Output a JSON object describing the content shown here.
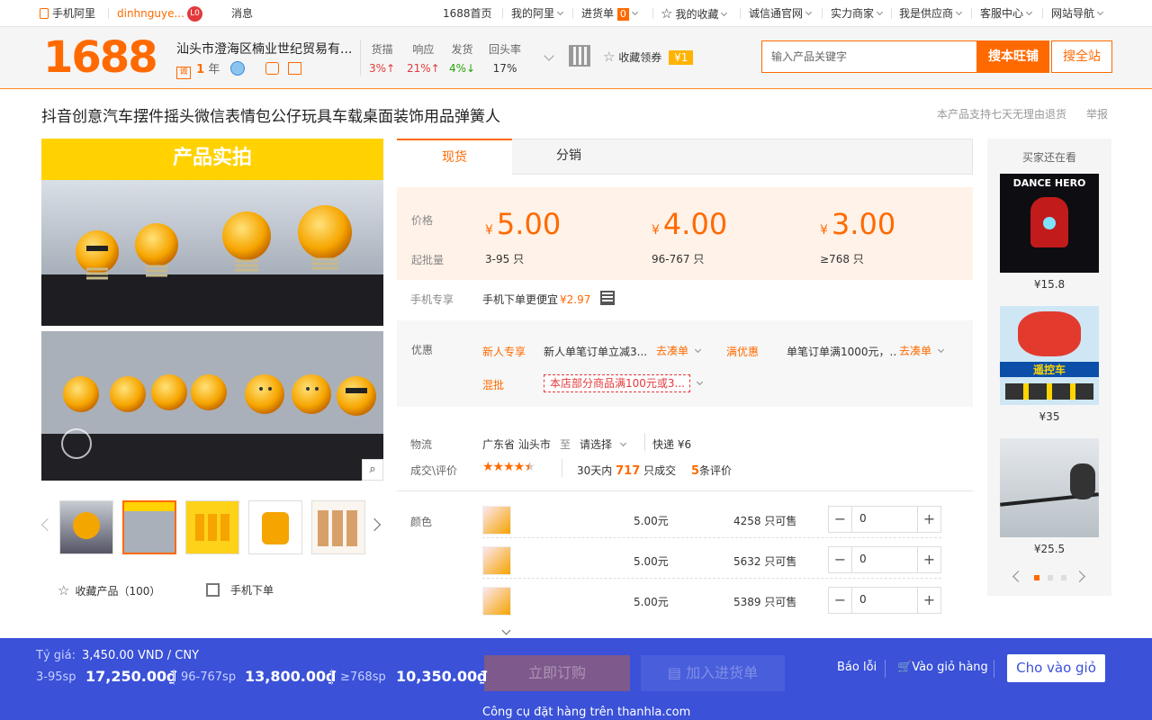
{
  "topbar": {
    "mobile": "手机阿里",
    "user": "dinhnguye...",
    "user_badge": "L0",
    "messages": "消息",
    "home": "1688首页",
    "my_ali": "我的阿里",
    "purchase": "进货单",
    "purchase_count": "0",
    "favorites": "我的收藏",
    "cxt": "诚信通官网",
    "merchant": "实力商家",
    "supplier": "我是供应商",
    "service": "客服中心",
    "nav": "网站导航"
  },
  "header": {
    "logo": "1688",
    "shop_name": "汕头市澄海区楠业世纪贸易有...",
    "years_num": "1",
    "years_unit": "年",
    "metrics": [
      {
        "label": "货描",
        "value": "3%↑",
        "color": "#e4393c"
      },
      {
        "label": "响应",
        "value": "21%↑",
        "color": "#e4393c"
      },
      {
        "label": "发货",
        "value": "4%↓",
        "color": "#2aa10f"
      },
      {
        "label": "回头率",
        "value": "17%",
        "color": "#333333"
      }
    ],
    "coupon_label": "收藏领券",
    "coupon_value": "¥1",
    "search_placeholder": "输入产品关键字",
    "search_shop": "搜本旺铺",
    "search_all": "搜全站"
  },
  "product": {
    "title": "抖音创意汽车摆件摇头微信表情包公仔玩具车载桌面装饰用品弹簧人",
    "return_policy": "本产品支持七天无理由退货",
    "report": "举报",
    "banner": "产品实拍",
    "fav": "收藏产品（100）",
    "mobile_order": "手机下单"
  },
  "tabs": [
    "现货",
    "分销"
  ],
  "pricing": {
    "price_label": "价格",
    "qty_label": "起批量",
    "currency": "¥",
    "tiers": [
      {
        "price": "5.00",
        "range": "3-95",
        "unit": "只"
      },
      {
        "price": "4.00",
        "range": "96-767",
        "unit": "只"
      },
      {
        "price": "3.00",
        "range": "≥768",
        "unit": "只"
      }
    ]
  },
  "mobile_special": {
    "label": "手机专享",
    "text": "手机下单更便宜",
    "price": "¥2.97"
  },
  "promo": {
    "label": "优惠",
    "newuser_tag": "新人专享",
    "newuser_text": "新人单笔订单立减3...",
    "collect": "去凑单",
    "full_tag": "满优惠",
    "full_text": "单笔订单满1000元，...",
    "mix_tag": "混批",
    "mix_text": "本店部分商品满100元或3..."
  },
  "logistics": {
    "label": "物流",
    "from": "广东省 汕头市",
    "to": "至",
    "select": "请选择",
    "express": "快递 ¥6"
  },
  "reviews": {
    "label": "成交\\评价",
    "rating": 4.5,
    "days": "30天内",
    "sold": "717",
    "sold_unit": "只成交",
    "count": "5",
    "count_unit": "条评价"
  },
  "variants": {
    "label": "颜色",
    "rows": [
      {
        "price": "5.00元",
        "stock": "4258",
        "stock_unit": "只可售",
        "qty": "0"
      },
      {
        "price": "5.00元",
        "stock": "5632",
        "stock_unit": "只可售",
        "qty": "0"
      },
      {
        "price": "5.00元",
        "stock": "5389",
        "stock_unit": "只可售",
        "qty": "0"
      }
    ]
  },
  "order_buttons": {
    "order": "立即订购",
    "cart": "加入进货单"
  },
  "sidebar": {
    "title": "买家还在看",
    "items": [
      {
        "price": "¥15.8",
        "overlay": "DANCE HERO"
      },
      {
        "price": "¥35",
        "overlay": "遥控车"
      },
      {
        "price": "¥25.5",
        "overlay": ""
      }
    ]
  },
  "thanhla": {
    "rate_label": "Tỷ giá:",
    "rate_value": "3,450.00 VND / CNY",
    "tiers": [
      {
        "range": "3-95sp",
        "price": "17,250.00₫"
      },
      {
        "range": "96-767sp",
        "price": "13,800.00₫"
      },
      {
        "range": "≥768sp",
        "price": "10,350.00₫"
      }
    ],
    "report": "Báo lỗi",
    "cart": "Vào giỏ hàng",
    "add": "Cho vào giỏ",
    "footer": "Công cụ đặt hàng trên thanhla.com"
  },
  "colors": {
    "accent": "#ff6a00",
    "bar": "#3a51d8",
    "price_bg": "#fff2e8"
  }
}
